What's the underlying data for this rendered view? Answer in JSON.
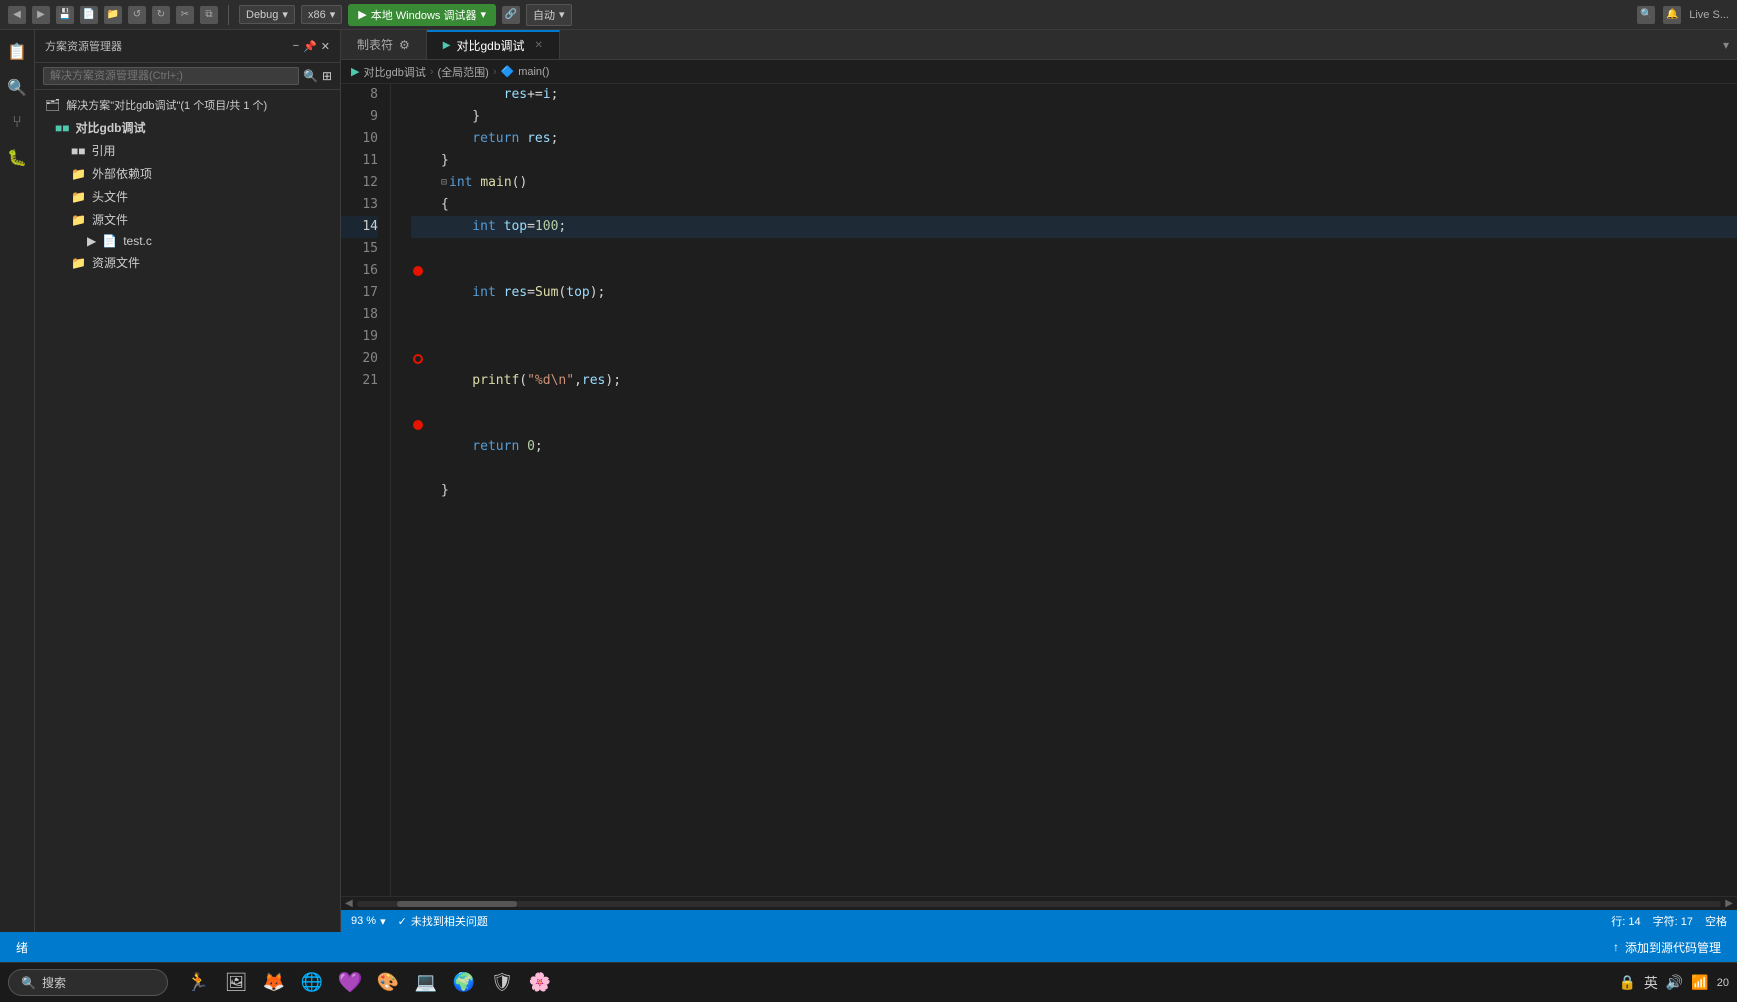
{
  "toolbar": {
    "debug_config": "Debug",
    "platform": "x86",
    "run_label": "本地 Windows 调试器",
    "auto_label": "自动",
    "live_share": "Live S...",
    "back_btn": "◀",
    "forward_btn": "▶",
    "icons": [
      "↺",
      "↪",
      "⊞",
      "⊟",
      "⊡",
      "◈",
      "⊞"
    ]
  },
  "sidebar": {
    "header": "方案资源管理器",
    "search_placeholder": "解决方案资源管理器(Ctrl+;)",
    "solution_label": "解决方案\"对比gdb调试\"(1 个项目/共 1 个)",
    "project_label": "对比gdb调试",
    "items": [
      {
        "label": "引用",
        "icon": "📦",
        "indent": 1
      },
      {
        "label": "外部依赖项",
        "icon": "📁",
        "indent": 1
      },
      {
        "label": "头文件",
        "icon": "📁",
        "indent": 1
      },
      {
        "label": "源文件",
        "icon": "📁",
        "indent": 1
      },
      {
        "label": "test.c",
        "icon": "📄",
        "indent": 2
      },
      {
        "label": "资源文件",
        "icon": "📁",
        "indent": 1
      }
    ]
  },
  "tabs": {
    "tab1_label": "制表符",
    "tab1_settings": "⚙",
    "tab2_label": "对比gdb调试",
    "tab2_icon": "▶",
    "breadcrumb": {
      "scope": "(全局范围)",
      "method": "main()"
    }
  },
  "editor": {
    "file_tab": "test.c",
    "lines": [
      {
        "num": 8,
        "content": "        res+=i;",
        "tokens": [
          {
            "t": "var",
            "v": "        res"
          },
          {
            "t": "op",
            "v": "+="
          },
          {
            "t": "var",
            "v": "i"
          },
          {
            "t": "punc",
            "v": ";"
          }
        ]
      },
      {
        "num": 9,
        "content": "    }",
        "tokens": [
          {
            "t": "punc",
            "v": "    }"
          }
        ]
      },
      {
        "num": 10,
        "content": "    return res;",
        "tokens": [
          {
            "t": "kw",
            "v": "    return"
          },
          {
            "t": "op",
            "v": " "
          },
          {
            "t": "var",
            "v": "res"
          },
          {
            "t": "punc",
            "v": ";"
          }
        ]
      },
      {
        "num": 11,
        "content": "}",
        "tokens": [
          {
            "t": "punc",
            "v": "}"
          }
        ]
      },
      {
        "num": 12,
        "content": "⊟int main()",
        "tokens": [
          {
            "t": "kw",
            "v": "int "
          },
          {
            "t": "fn",
            "v": "main"
          },
          {
            "t": "punc",
            "v": "()"
          }
        ],
        "fold": true
      },
      {
        "num": 13,
        "content": "{",
        "tokens": [
          {
            "t": "punc",
            "v": "{"
          }
        ]
      },
      {
        "num": 14,
        "content": "    int top=100;",
        "tokens": [
          {
            "t": "kw",
            "v": "    int "
          },
          {
            "t": "var",
            "v": "top"
          },
          {
            "t": "op",
            "v": "="
          },
          {
            "t": "num",
            "v": "100"
          },
          {
            "t": "punc",
            "v": ";"
          }
        ],
        "active": true
      },
      {
        "num": 15,
        "content": "",
        "tokens": []
      },
      {
        "num": 16,
        "content": "    int res=Sum(top);",
        "tokens": [
          {
            "t": "kw",
            "v": "    int "
          },
          {
            "t": "var",
            "v": "res"
          },
          {
            "t": "op",
            "v": "="
          },
          {
            "t": "fn",
            "v": "Sum"
          },
          {
            "t": "punc",
            "v": "("
          },
          {
            "t": "var",
            "v": "top"
          },
          {
            "t": "punc",
            "v": ");"
          }
        ],
        "breakpoint": "filled"
      },
      {
        "num": 17,
        "content": "",
        "tokens": []
      },
      {
        "num": 18,
        "content": "    printf(\"%d\\n\",res);",
        "tokens": [
          {
            "t": "fn",
            "v": "    printf"
          },
          {
            "t": "punc",
            "v": "("
          },
          {
            "t": "str",
            "v": "\"%d\\n\""
          },
          {
            "t": "punc",
            "v": ","
          },
          {
            "t": "var",
            "v": "res"
          },
          {
            "t": "punc",
            "v": ");"
          }
        ],
        "breakpoint": "hollow"
      },
      {
        "num": 19,
        "content": "    return 0;",
        "tokens": [
          {
            "t": "kw",
            "v": "    return "
          },
          {
            "t": "num",
            "v": "0"
          },
          {
            "t": "punc",
            "v": ";"
          }
        ],
        "breakpoint": "filled"
      },
      {
        "num": 20,
        "content": "}",
        "tokens": [
          {
            "t": "punc",
            "v": "}"
          }
        ]
      },
      {
        "num": 21,
        "content": "",
        "tokens": []
      }
    ]
  },
  "status_bar": {
    "zoom": "93 %",
    "status_icon": "✓",
    "status_text": "未找到相关问题",
    "line": "行: 14",
    "col": "字符: 17",
    "encoding": "空格",
    "bottom_text": "添加到源代码管理"
  },
  "taskbar": {
    "search_label": "搜索",
    "time": "20",
    "lang": "英",
    "icons": [
      "🔍",
      "🏃",
      "🖼",
      "🦊",
      "🌐",
      "💻",
      "🎮",
      "🌍",
      "🛡",
      "🌸"
    ],
    "tray": [
      "🔒",
      "英",
      "🔊",
      "📶"
    ]
  }
}
